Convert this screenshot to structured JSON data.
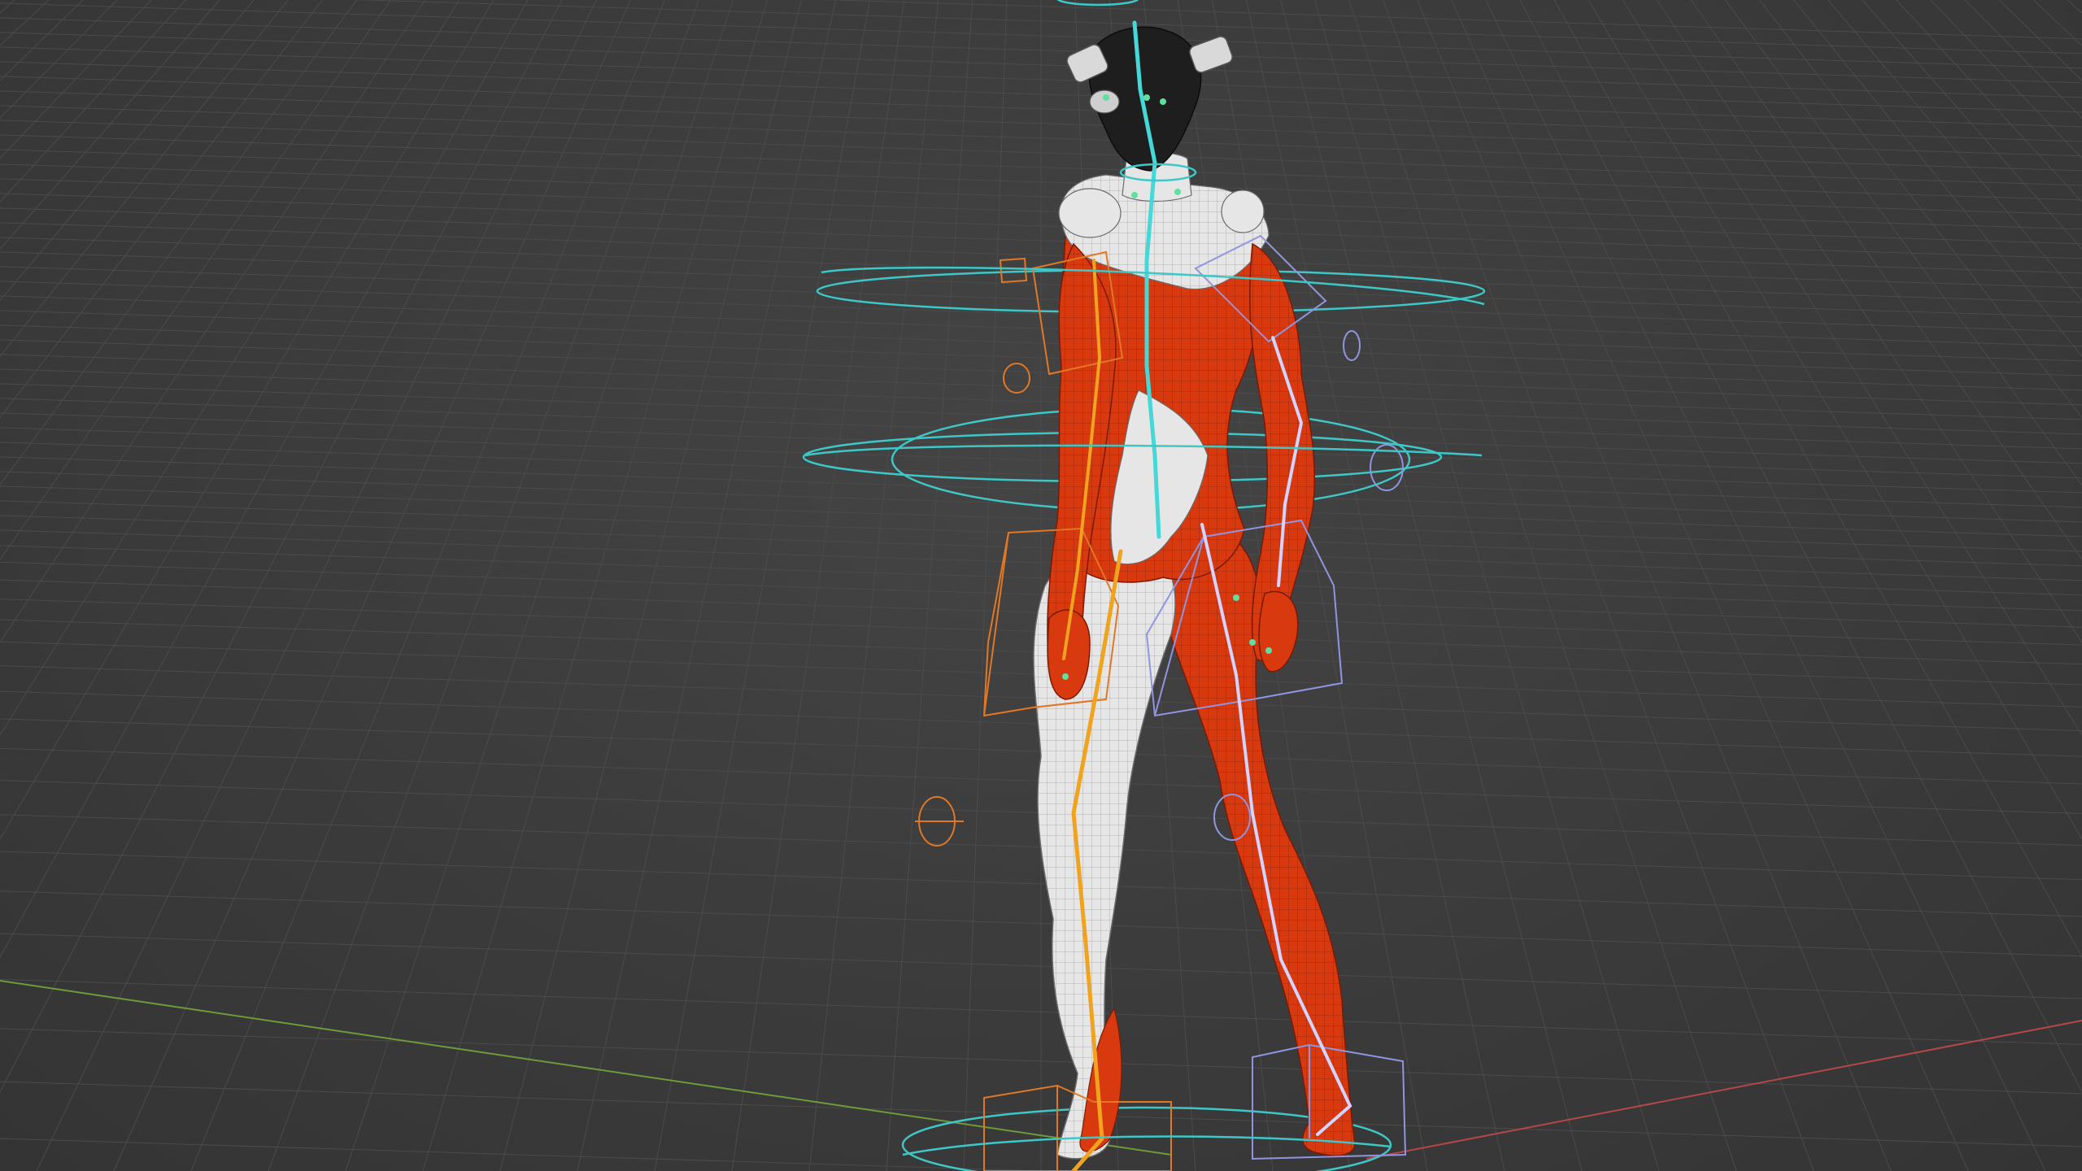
{
  "viewport": {
    "type": "3d-viewport",
    "view": "perspective",
    "shading": "wireframe-overlay",
    "show_grid": true,
    "show_axes": [
      "x",
      "y"
    ]
  },
  "scene": {
    "object": "character-mesh",
    "rig": "armature",
    "colors": {
      "background": "#3d3d3d",
      "grid": "#4a4a4a",
      "axis_x": "#b34848",
      "axis_y": "#6f9a3c",
      "mesh_red": "#d8390f",
      "mesh_white": "#e6e6e6",
      "helmet": "#1e1e1e",
      "control_cyan": "#3fc7c7",
      "control_orange": "#e07826",
      "control_blue": "#8f95e0",
      "bone_spine": "#46d7d7",
      "bone_left_leg": "#f0a31e",
      "bone_right_leg": "#d2d4ff"
    }
  }
}
